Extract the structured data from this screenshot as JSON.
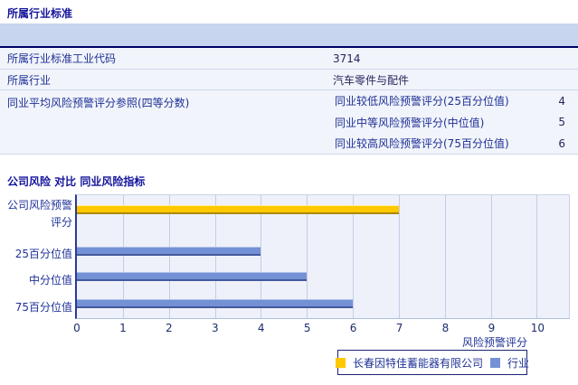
{
  "section_industry": {
    "title": "所属行业标准",
    "rows": [
      {
        "label": "所属行业标准工业代码",
        "value": "3714"
      },
      {
        "label": "所属行业",
        "value": "汽车零件与配件"
      },
      {
        "label": "同业平均风险预警评分参照(四等分数)",
        "sub_rows": [
          {
            "label": "同业较低风险预警评分(25百分位值)",
            "value": "4"
          },
          {
            "label": "同业中等风险预警评分(中位值)",
            "value": "5"
          },
          {
            "label": "同业较高风险预警评分(75百分位值)",
            "value": "6"
          }
        ]
      }
    ]
  },
  "section_chart": {
    "title": "公司风险 对比 同业风险指标"
  },
  "chart_data": {
    "type": "bar",
    "orientation": "horizontal",
    "title": "公司风险 对比 同业风险指标",
    "xlabel": "风险预警评分",
    "xlim": [
      0,
      10.7
    ],
    "ticks": [
      0,
      1,
      2,
      3,
      4,
      5,
      6,
      7,
      8,
      9,
      10
    ],
    "grid": true,
    "legend_position": "bottom",
    "categories": [
      "公司风险预警评分",
      "25百分位值",
      "中分位值",
      "75百分位值"
    ],
    "category_label_lines": [
      [
        "公司风险预警",
        "评分"
      ],
      [
        "25百分位值"
      ],
      [
        "中分位值"
      ],
      [
        "75百分位值"
      ]
    ],
    "bars": [
      {
        "category": "公司风险预警评分",
        "series": "长春因特佳蓄能器有限公司",
        "value": 7
      },
      {
        "category": "25百分位值",
        "series": "行业",
        "value": 4
      },
      {
        "category": "中分位值",
        "series": "行业",
        "value": 5
      },
      {
        "category": "75百分位值",
        "series": "行业",
        "value": 6
      }
    ],
    "series": [
      {
        "name": "长春因特佳蓄能器有限公司",
        "color": "#ffc800",
        "edge_light": "#ffeda0",
        "edge_dark": "#a98a00"
      },
      {
        "name": "行业",
        "color": "#7591d5",
        "edge_light": "#b0c2ea",
        "edge_dark": "#44589c"
      }
    ],
    "colors": {
      "plot_bg": "#eef1f9",
      "gridline": "#c3cde6",
      "axis": "#2b3a90"
    }
  }
}
